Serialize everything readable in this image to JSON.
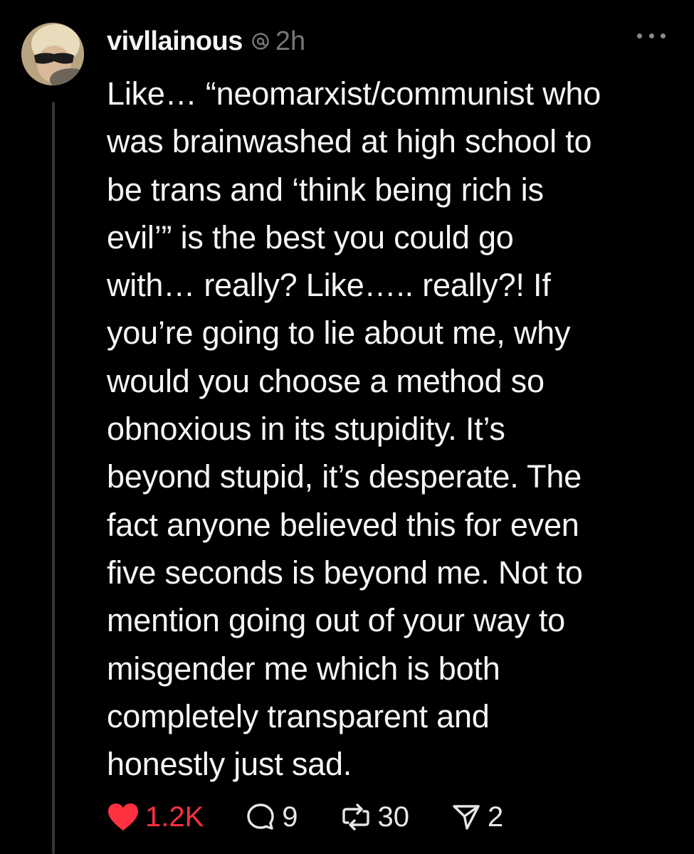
{
  "post": {
    "username": "vivllainous",
    "time": "2h",
    "body": "Like… “neomarxist/communist who\nwas brainwashed at high school to\nbe trans and ‘think being rich is\nevil’” is the best you could go\nwith… really? Like….. really?! If\nyou’re going to lie about me, why\nwould you choose a method so\nobnoxious in its stupidity. It’s\nbeyond stupid, it’s desperate. The\nfact anyone believed this for even\nfive seconds is beyond me. Not to\nmention going out of your way to\nmisgender me which is both\ncompletely transparent and\nhonestly just sad."
  },
  "actions": {
    "likes": "1.2K",
    "replies": "9",
    "reposts": "30",
    "shares": "2"
  },
  "icons": {
    "header": [
      "threads-logo-icon",
      "more-options-icon"
    ],
    "actions": [
      "heart-icon",
      "reply-bubble-icon",
      "repost-icon",
      "share-send-icon"
    ]
  },
  "colors": {
    "background": "#000000",
    "text": "#f3f5f7",
    "muted": "#777777",
    "like": "#ff3040",
    "thread_line": "#333638"
  }
}
